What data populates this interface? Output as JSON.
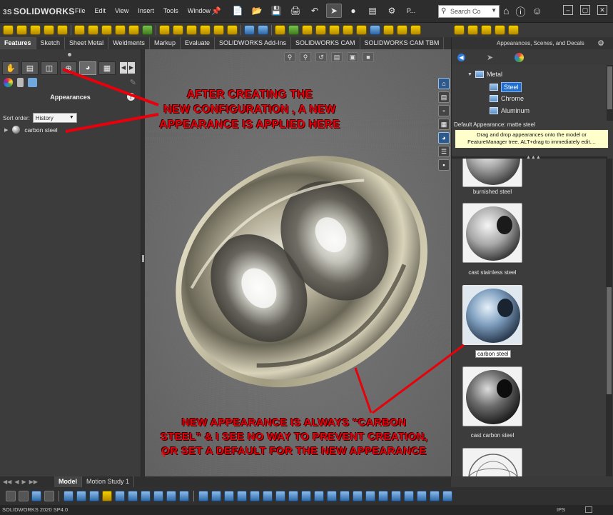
{
  "titlebar": {
    "app_name": "SOLIDWORKS",
    "ds_mark": "3S",
    "menu": [
      "File",
      "Edit",
      "View",
      "Insert",
      "Tools",
      "Window"
    ],
    "extra": "P...",
    "search_placeholder": "Search Co"
  },
  "tabs": [
    "Features",
    "Sketch",
    "Sheet Metal",
    "Weldments",
    "Markup",
    "Evaluate",
    "SOLIDWORKS Add-Ins",
    "SOLIDWORKS CAM",
    "SOLIDWORKS CAM TBM"
  ],
  "left_panel": {
    "title": "Appearances",
    "sort_label": "Sort order:",
    "sort_value": "History",
    "item": "carbon steel"
  },
  "task_pane": {
    "title": "Appearances, Scenes, and Decals",
    "tree": {
      "metal": "Metal",
      "steel": "Steel",
      "chrome": "Chrome",
      "aluminum": "Aluminum"
    },
    "default_appearance": "Default Appearance: matte steel",
    "tooltip": "Drag and drop appearances onto the model or FeatureManager tree.  ALT+drag to immediately edit....",
    "thumbnails": [
      "burnished steel",
      "cast stainless steel",
      "carbon steel",
      "cast carbon steel"
    ]
  },
  "annotations": {
    "top": "AFTER CREATING THE NEW CONFIGURATION , A NEW APPEARANCE IS APPLIED HERE",
    "top_lines": [
      "AFTER CREATING THE",
      "NEW CONFIGURATION , A NEW",
      "APPEARANCE IS APPLIED HERE"
    ],
    "bottom_lines": [
      "NEW APPEARANCE IS ALWAYS “CARBON",
      "STEEL” & I SEE NO WAY TO PREVENT CREATION,",
      "OR SET A DEFAULT FOR THE NEW APPEARANCE"
    ]
  },
  "bottom_tabs": [
    "Model",
    "Motion Study 1"
  ],
  "status": {
    "version": "SOLIDWORKS 2020 SP4.0",
    "units": "IPS"
  },
  "colors": {
    "annotation_red": "#e8000b",
    "selection_blue": "#1f6fd1",
    "tooltip_yellow": "#ffffcc"
  }
}
